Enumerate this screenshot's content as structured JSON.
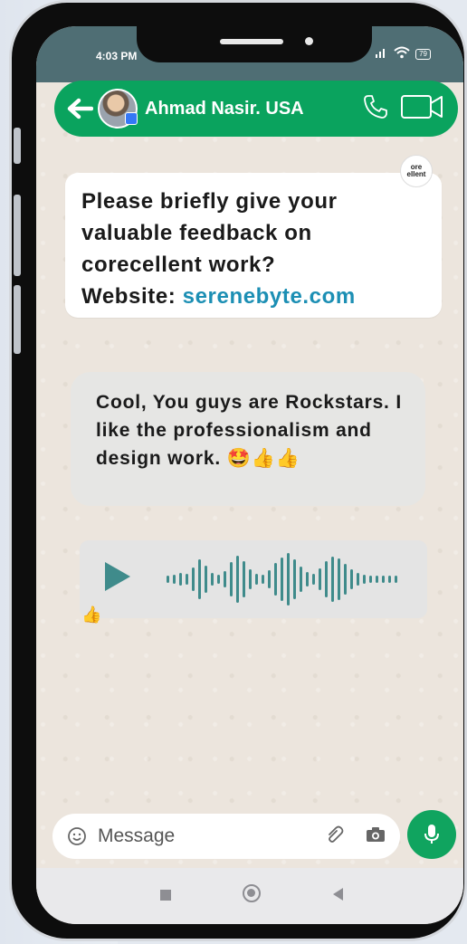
{
  "status_bar": {
    "time": "4:03 PM",
    "wifi_icon": "wifi-icon",
    "battery": "79"
  },
  "header": {
    "contact_name": "Ahmad Nasir. USA",
    "back_icon": "back-arrow-icon",
    "call_icon": "phone-icon",
    "video_icon": "video-camera-icon",
    "accent_color": "#0aa35e"
  },
  "messages": [
    {
      "text_line1": "Please briefly give your",
      "text_line2": "valuable feedback on",
      "text_line3": "corecellent work?",
      "website_label": "Website: ",
      "website_link": "serenebyte.com",
      "sender_logo_text_1": "ore",
      "sender_logo_text_2": "ellent"
    },
    {
      "text": "Cool, You guys are Rockstars. I like the professionalism and design work.",
      "emoji": "🤩👍👍"
    },
    {
      "type": "voice",
      "play_icon": "play-icon",
      "reaction": "👍"
    }
  ],
  "input": {
    "placeholder": "Message",
    "emoji_icon": "smiley-icon",
    "attach_icon": "paperclip-icon",
    "camera_icon": "camera-icon",
    "mic_icon": "microphone-icon"
  },
  "nav": {
    "recent_icon": "recents-icon",
    "home_icon": "home-icon",
    "back_icon": "back-triangle-icon"
  }
}
